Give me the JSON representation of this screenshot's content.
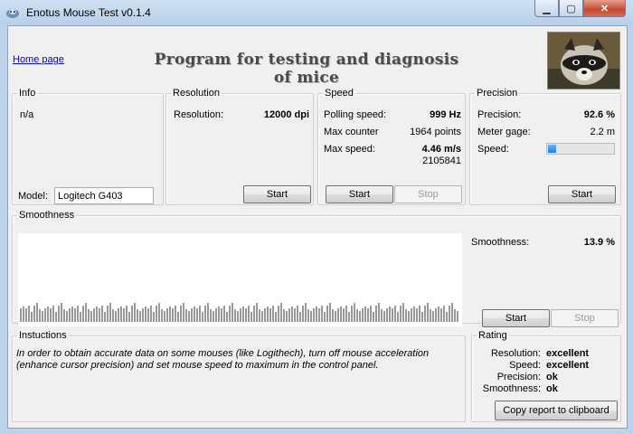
{
  "window": {
    "title": "Enotus Mouse Test v0.1.4",
    "minimize_glyph": "▁",
    "maximize_glyph": "▢",
    "close_glyph": "✕"
  },
  "header": {
    "home_link": "Home page",
    "program_title": "Program for testing and diagnosis of mice",
    "image": "raccoon-photo"
  },
  "info": {
    "legend": "Info",
    "text": "n/a",
    "model_label": "Model:",
    "model_value": "Logitech G403"
  },
  "resolution": {
    "legend": "Resolution",
    "label": "Resolution:",
    "value": "12000 dpi",
    "start": "Start"
  },
  "speed": {
    "legend": "Speed",
    "polling_label": "Polling speed:",
    "polling_value": "999 Hz",
    "counter_label": "Max counter",
    "counter_value": "1964 points",
    "max_speed_label": "Max  speed:",
    "max_speed_value": "4.46 m/s",
    "max_speed_sub": "2105841",
    "start": "Start",
    "stop": "Stop"
  },
  "precision": {
    "legend": "Precision",
    "precision_label": "Precision:",
    "precision_value": "92.6 %",
    "gage_label": "Meter gage:",
    "gage_value": "2.2 m",
    "speed_label": "Speed:",
    "speed_bar_fraction": 0.13,
    "start": "Start"
  },
  "smoothness": {
    "legend": "Smoothness",
    "label": "Smoothness:",
    "value": "13.9 %",
    "start": "Start",
    "stop": "Stop"
  },
  "instructions": {
    "legend": "Instuctions",
    "text": "In order to obtain accurate data on some mouses (like Logithech), turn off mouse acceleration (enhance cursor precision) and set mouse speed to maximum in the control panel."
  },
  "rating": {
    "legend": "Rating",
    "rows": [
      {
        "label": "Resolution:",
        "value": "excellent"
      },
      {
        "label": "Speed:",
        "value": "excellent"
      },
      {
        "label": "Precision:",
        "value": "ok"
      },
      {
        "label": "Smoothness:",
        "value": "ok"
      }
    ],
    "copy_button": "Copy report to clipboard"
  },
  "colors": {
    "accent": "#1c7ee6",
    "title_text": "#4a4a4a",
    "link": "#0000cc"
  }
}
